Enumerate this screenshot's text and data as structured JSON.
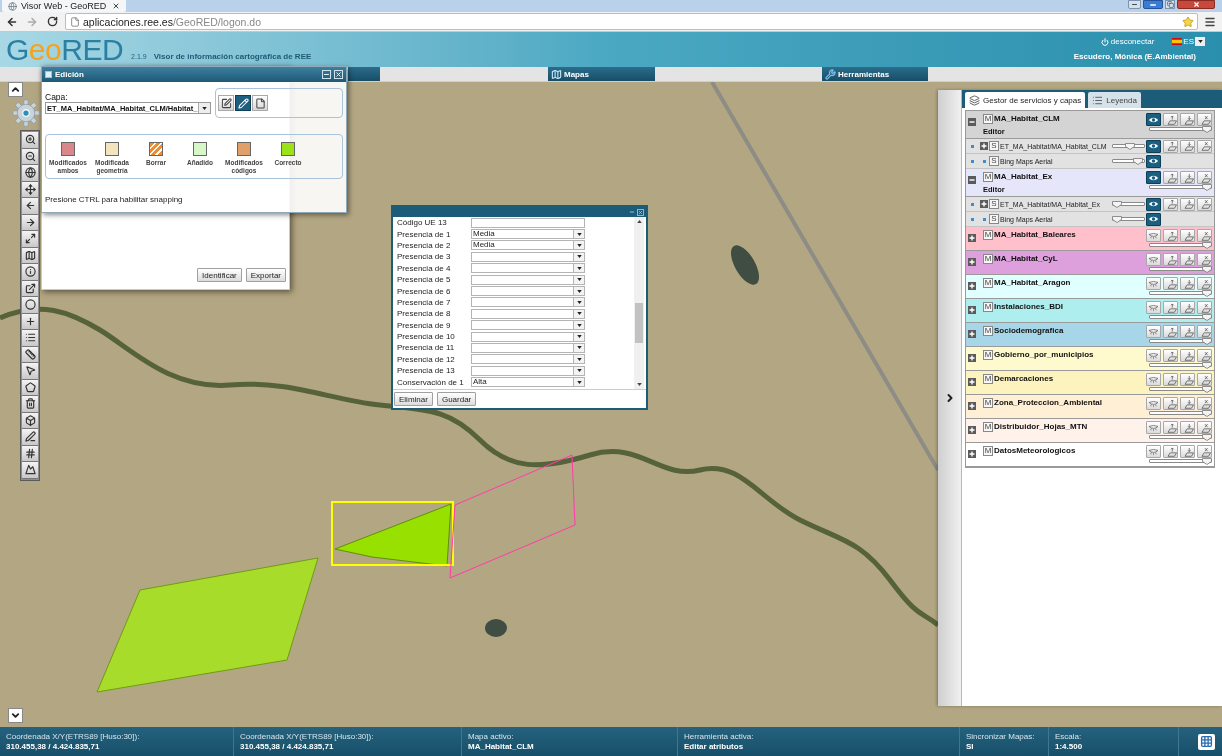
{
  "browser": {
    "tab_title": "Visor Web - GeoRED",
    "url_host": "aplicaciones.ree.es",
    "url_path": "/GeoRED/logon.do"
  },
  "header": {
    "logo": [
      {
        "text": "G",
        "color": "#2b7fa3"
      },
      {
        "text": "eo",
        "color": "#f5a21c"
      },
      {
        "text": "RED",
        "color": "#2b7fa3"
      }
    ],
    "version": "2.1.9",
    "subtitle": "Visor de información cartográfica de REE",
    "logout": "desconectar",
    "language": "ES",
    "user": "Escudero, Mónica (E.Ambiental)"
  },
  "nav_tabs": [
    {
      "label": "Mapas"
    },
    {
      "label": "Herramientas"
    }
  ],
  "identify_panel": {
    "buttons": [
      "Identificar",
      "Exportar"
    ]
  },
  "edit_panel": {
    "title": "Edición",
    "layer_label": "Capa:",
    "layer_value": "ET_MA_Habitat/MA_Habitat_CLM/Habitat_",
    "tools": [
      {
        "selected": false
      },
      {
        "selected": true
      },
      {
        "selected": false
      }
    ],
    "legend": [
      {
        "label": "Modificados ambos",
        "color": "#d9878c",
        "kind": "solid"
      },
      {
        "label": "Modificada geometría",
        "color": "#f2e4bd",
        "kind": "solid"
      },
      {
        "label": "Borrar",
        "color": "#f08c30",
        "kind": "striped"
      },
      {
        "label": "Añadido",
        "color": "#d6f8c8",
        "kind": "solid"
      },
      {
        "label": "Modificados códigos",
        "color": "#e0a06a",
        "kind": "solid"
      },
      {
        "label": "Correcto",
        "color": "#9be21a",
        "kind": "solid"
      }
    ],
    "hint": "Presione CTRL para habilitar snapping"
  },
  "attributes_dialog": {
    "fields": [
      {
        "label": "Código UE 13",
        "kind": "text"
      },
      {
        "label": "Presencia de 1",
        "kind": "select",
        "value": "Media"
      },
      {
        "label": "Presencia de 2",
        "kind": "select",
        "value": "Media"
      },
      {
        "label": "Presencia de 3",
        "kind": "select"
      },
      {
        "label": "Presencia de 4",
        "kind": "select"
      },
      {
        "label": "Presencia de 5",
        "kind": "select"
      },
      {
        "label": "Presencia de 6",
        "kind": "select"
      },
      {
        "label": "Presencia de 7",
        "kind": "select"
      },
      {
        "label": "Presencia de 8",
        "kind": "select"
      },
      {
        "label": "Presencia de 9",
        "kind": "select"
      },
      {
        "label": "Presencia de 10",
        "kind": "select"
      },
      {
        "label": "Presencia de 11",
        "kind": "select"
      },
      {
        "label": "Presencia de 12",
        "kind": "select"
      },
      {
        "label": "Presencia de 13",
        "kind": "select"
      },
      {
        "label": "Conservación de 1",
        "kind": "select",
        "value": "Alta"
      }
    ],
    "buttons": [
      "Eliminar",
      "Guardar"
    ]
  },
  "layers_panel": {
    "tabs": [
      {
        "label": "Gestor de servicios y capas",
        "selected": true
      },
      {
        "label": "Leyenda",
        "selected": false
      }
    ],
    "layers": [
      {
        "badge": "M",
        "name": "MA_Habitat_CLM",
        "subtitle": "Editor",
        "expanded": true,
        "visible": true,
        "level": 1,
        "color": "#d4d4d4",
        "children": [
          {
            "kind": "layer",
            "badge": "S",
            "name": "ET_MA_Habitat/MA_Habitat_CLM",
            "expanded": false,
            "visible": true,
            "level": 0.55
          },
          {
            "kind": "basemap",
            "badge": "S",
            "name": "Bing Maps Aerial",
            "visible": true,
            "level": 0.9
          }
        ]
      },
      {
        "badge": "M",
        "name": "MA_Habitat_Ex",
        "subtitle": "Editor",
        "expanded": true,
        "visible": true,
        "level": 1,
        "color": "#e6e6fa",
        "children": [
          {
            "kind": "layer",
            "badge": "S",
            "name": "ET_MA_Habitat/MA_Habitat_Ex",
            "expanded": false,
            "visible": true,
            "level": 0
          },
          {
            "kind": "basemap",
            "badge": "S",
            "name": "Bing Maps Aerial",
            "visible": true,
            "level": 0
          }
        ]
      },
      {
        "badge": "M",
        "name": "MA_Habitat_Baleares",
        "expanded": false,
        "visible": false,
        "level": 1,
        "color": "#ffc0cb"
      },
      {
        "badge": "M",
        "name": "MA_Habitat_CyL",
        "expanded": false,
        "visible": false,
        "level": 1,
        "color": "#dda0dd"
      },
      {
        "badge": "M",
        "name": "MA_Habitat_Aragon",
        "expanded": false,
        "visible": false,
        "level": 1,
        "color": "#e0ffff"
      },
      {
        "badge": "M",
        "name": "Instalaciones_BDI",
        "expanded": false,
        "visible": false,
        "level": 1,
        "color": "#afeeee"
      },
      {
        "badge": "M",
        "name": "Sociodemografica",
        "expanded": false,
        "visible": false,
        "level": 1,
        "color": "#a6d6e8"
      },
      {
        "badge": "M",
        "name": "Gobierno_por_municipios",
        "expanded": false,
        "visible": false,
        "level": 1,
        "color": "#fffacd"
      },
      {
        "badge": "M",
        "name": "Demarcaciones",
        "expanded": false,
        "visible": false,
        "level": 1,
        "color": "#fdf3bf"
      },
      {
        "badge": "M",
        "name": "Zona_Proteccion_Ambiental",
        "expanded": false,
        "visible": false,
        "level": 1,
        "color": "#ffefd5"
      },
      {
        "badge": "M",
        "name": "Distribuidor_Hojas_MTN",
        "expanded": false,
        "visible": false,
        "level": 1,
        "color": "#fff2ea"
      },
      {
        "badge": "M",
        "name": "DatosMeteorologicos",
        "expanded": false,
        "visible": false,
        "level": 1,
        "color": "#ffffff"
      }
    ]
  },
  "status_bar": [
    {
      "label": "Coordenada X/Y(ETRS89 [Huso:30]):",
      "value": "310.455,38 / 4.424.835,71"
    },
    {
      "label": "Coordenada X/Y(ETRS89 [Huso:30]):",
      "value": "310.455,38 / 4.424.835,71"
    },
    {
      "label": "Mapa activo:",
      "value": "MA_Habitat_CLM"
    },
    {
      "label": "Herramienta activa:",
      "value": "Editar atributos"
    },
    {
      "label": "Sincronizar Mapas:",
      "value": "SI"
    },
    {
      "label": "Escala:",
      "value": "1:4.500"
    }
  ]
}
